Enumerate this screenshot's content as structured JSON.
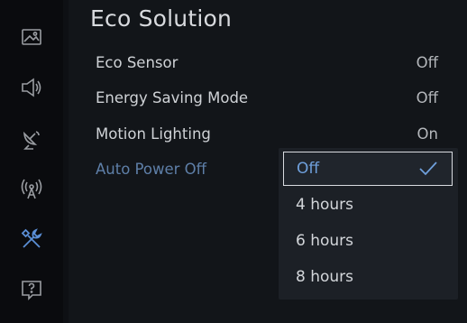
{
  "sidebar": {
    "icons": [
      "picture-icon",
      "sound-icon",
      "broadcasting-icon",
      "network-icon",
      "tools-icon",
      "support-icon"
    ],
    "active_icon": "tools-icon",
    "active_color": "#5b8fd6"
  },
  "title": "Eco Solution",
  "settings": [
    {
      "label": "Eco Sensor",
      "value": "Off"
    },
    {
      "label": "Energy Saving Mode",
      "value": "Off"
    },
    {
      "label": "Motion Lighting",
      "value": "On"
    },
    {
      "label": "Auto Power Off",
      "value": ""
    }
  ],
  "dropdown": {
    "options": [
      "Off",
      "4 hours",
      "6 hours",
      "8 hours"
    ],
    "selected": "Off",
    "selected_icon": "checkmark-icon",
    "highlight_color": "#6fa0dc"
  }
}
